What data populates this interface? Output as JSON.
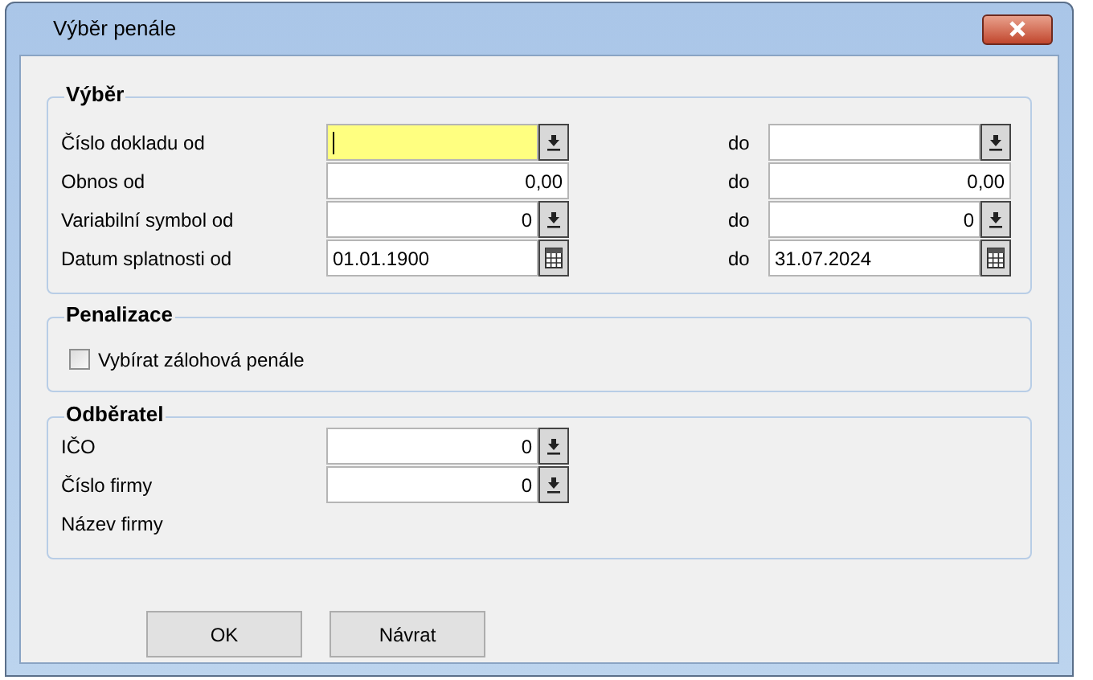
{
  "window": {
    "title": "Výběr penále"
  },
  "vyber": {
    "title": "Výběr",
    "rows": [
      {
        "label": "Číslo dokladu od",
        "from": {
          "kind": "lookup",
          "focused": true
        },
        "to_label": "do",
        "to": {
          "kind": "lookup",
          "focused": false
        }
      },
      {
        "label": "Obnos od",
        "from": {
          "kind": "amount",
          "value": "0,00",
          "focused": false
        },
        "to_label": "do",
        "to": {
          "kind": "amount",
          "value": "0,00",
          "focused": false
        }
      },
      {
        "label": "Variabilní symbol od",
        "from": {
          "kind": "lookup",
          "value": "0",
          "focused": false
        },
        "to_label": "do",
        "to": {
          "kind": "lookup",
          "value": "0",
          "focused": false
        }
      },
      {
        "label": "Datum splatnosti od",
        "from": {
          "kind": "date",
          "value": "01.01.1900",
          "focused": false
        },
        "to_label": "do",
        "to": {
          "kind": "date",
          "value": "31.07.2024",
          "focused": false
        }
      }
    ]
  },
  "penalizace": {
    "title": "Penalizace",
    "checkbox": {
      "label": "Vybírat zálohová penále",
      "checked": false
    }
  },
  "odberatel": {
    "title": "Odběratel",
    "rows": [
      {
        "label": "IČO",
        "field": {
          "kind": "lookup",
          "value": "0",
          "focused": false
        }
      },
      {
        "label": "Číslo firmy",
        "field": {
          "kind": "lookup",
          "value": "0",
          "focused": false
        }
      },
      {
        "label": "Název firmy"
      }
    ]
  },
  "buttons": [
    "OK",
    "Návrat"
  ]
}
